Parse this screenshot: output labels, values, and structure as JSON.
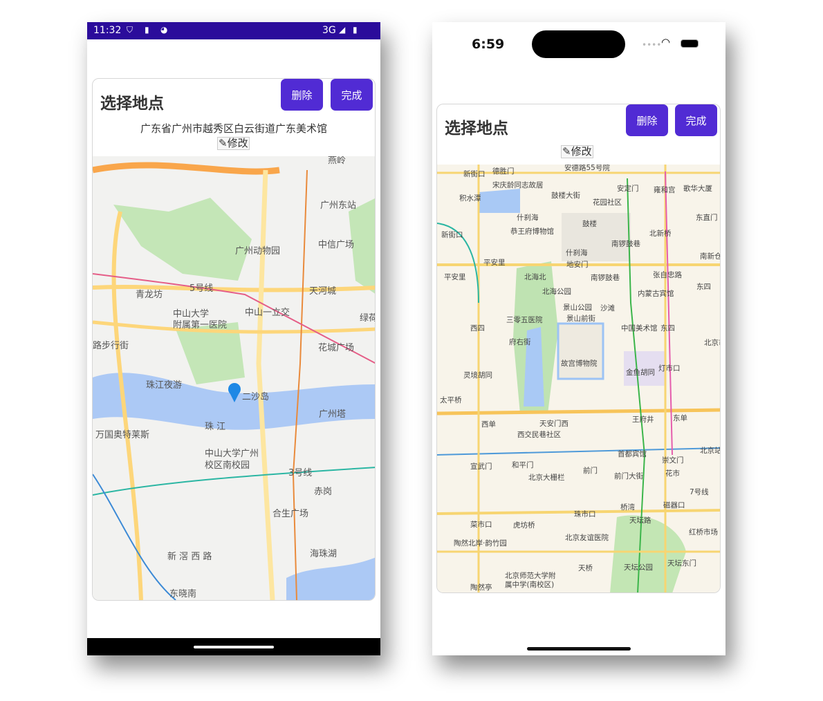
{
  "android": {
    "status": {
      "time": "11:32",
      "icons": [
        "shield-icon",
        "sd-card-icon",
        "face-icon"
      ],
      "network": "3G",
      "right_icons": [
        "signal-icon",
        "battery-icon"
      ]
    },
    "card": {
      "title": "选择地点",
      "delete_label": "删除",
      "done_label": "完成",
      "address": "广东省广州市越秀区白云街道广东美术馆",
      "edit_label": "修改",
      "edit_icon": "edit-icon"
    },
    "map_labels": [
      "广州东站",
      "中信广场",
      "广州动物园",
      "天河城",
      "青龙坊",
      "中山大学",
      "附属第一医院",
      "中山一立交",
      "花城广场",
      "路步行街",
      "珠江夜游",
      "二沙岛",
      "广州塔",
      "珠 江",
      "万国奥特莱斯",
      "中山大学广州",
      "校区南校园",
      "赤岗",
      "合生广场",
      "海珠湖",
      "新 滘 西 路",
      "东晓南",
      "5号线",
      "3号线",
      "绿荷",
      "燕岭"
    ],
    "pin_color": "#1e88e5"
  },
  "ios": {
    "status": {
      "time": "6:59",
      "icons": [
        "signal-dots-icon",
        "wifi-icon",
        "battery-icon"
      ]
    },
    "card": {
      "title": "选择地点",
      "delete_label": "删除",
      "done_label": "完成",
      "edit_label": "修改",
      "edit_icon": "edit-icon"
    },
    "map_labels": [
      "安德路55号院",
      "新街口",
      "德胜门",
      "宋庆龄同志故居",
      "积水潭",
      "鼓楼大街",
      "安定门",
      "雍和宫",
      "歌华大厦",
      "花园社区",
      "什刹海",
      "鼓楼",
      "东直门",
      "新街口",
      "恭王府博物馆",
      "北新桥",
      "南锣鼓巷",
      "什刹海",
      "南新仓",
      "平安里",
      "平安里",
      "北海北",
      "地安门",
      "南锣鼓巷",
      "张自忠路",
      "北海公园",
      "东四",
      "内蒙古宾馆",
      "景山公园",
      "沙滩",
      "三零五医院",
      "景山前街",
      "西四",
      "中国美术馆",
      "东四",
      "北京市",
      "府右街",
      "故宫博物院",
      "灯市口",
      "灵境胡同",
      "金鱼胡同",
      "太平桥",
      "天安门西",
      "王府井",
      "东单",
      "西单",
      "西交民巷社区",
      "首都宾馆",
      "崇文门",
      "北京站",
      "宣武门",
      "和平门",
      "前门",
      "花市",
      "北京大栅栏",
      "前门大街",
      "7号线",
      "菜市口",
      "虎坊桥",
      "珠市口",
      "桥湾",
      "磁器口",
      "天坛路",
      "陶然北岸·韵竹园",
      "北京友谊医院",
      "红桥市场",
      "天桥",
      "天坛公园",
      "天坛东门",
      "北京师范大学附",
      "属中学(南校区)",
      "陶然亭"
    ]
  },
  "colors": {
    "accent": "#512bd4",
    "android_status": "#2b0c9b"
  }
}
